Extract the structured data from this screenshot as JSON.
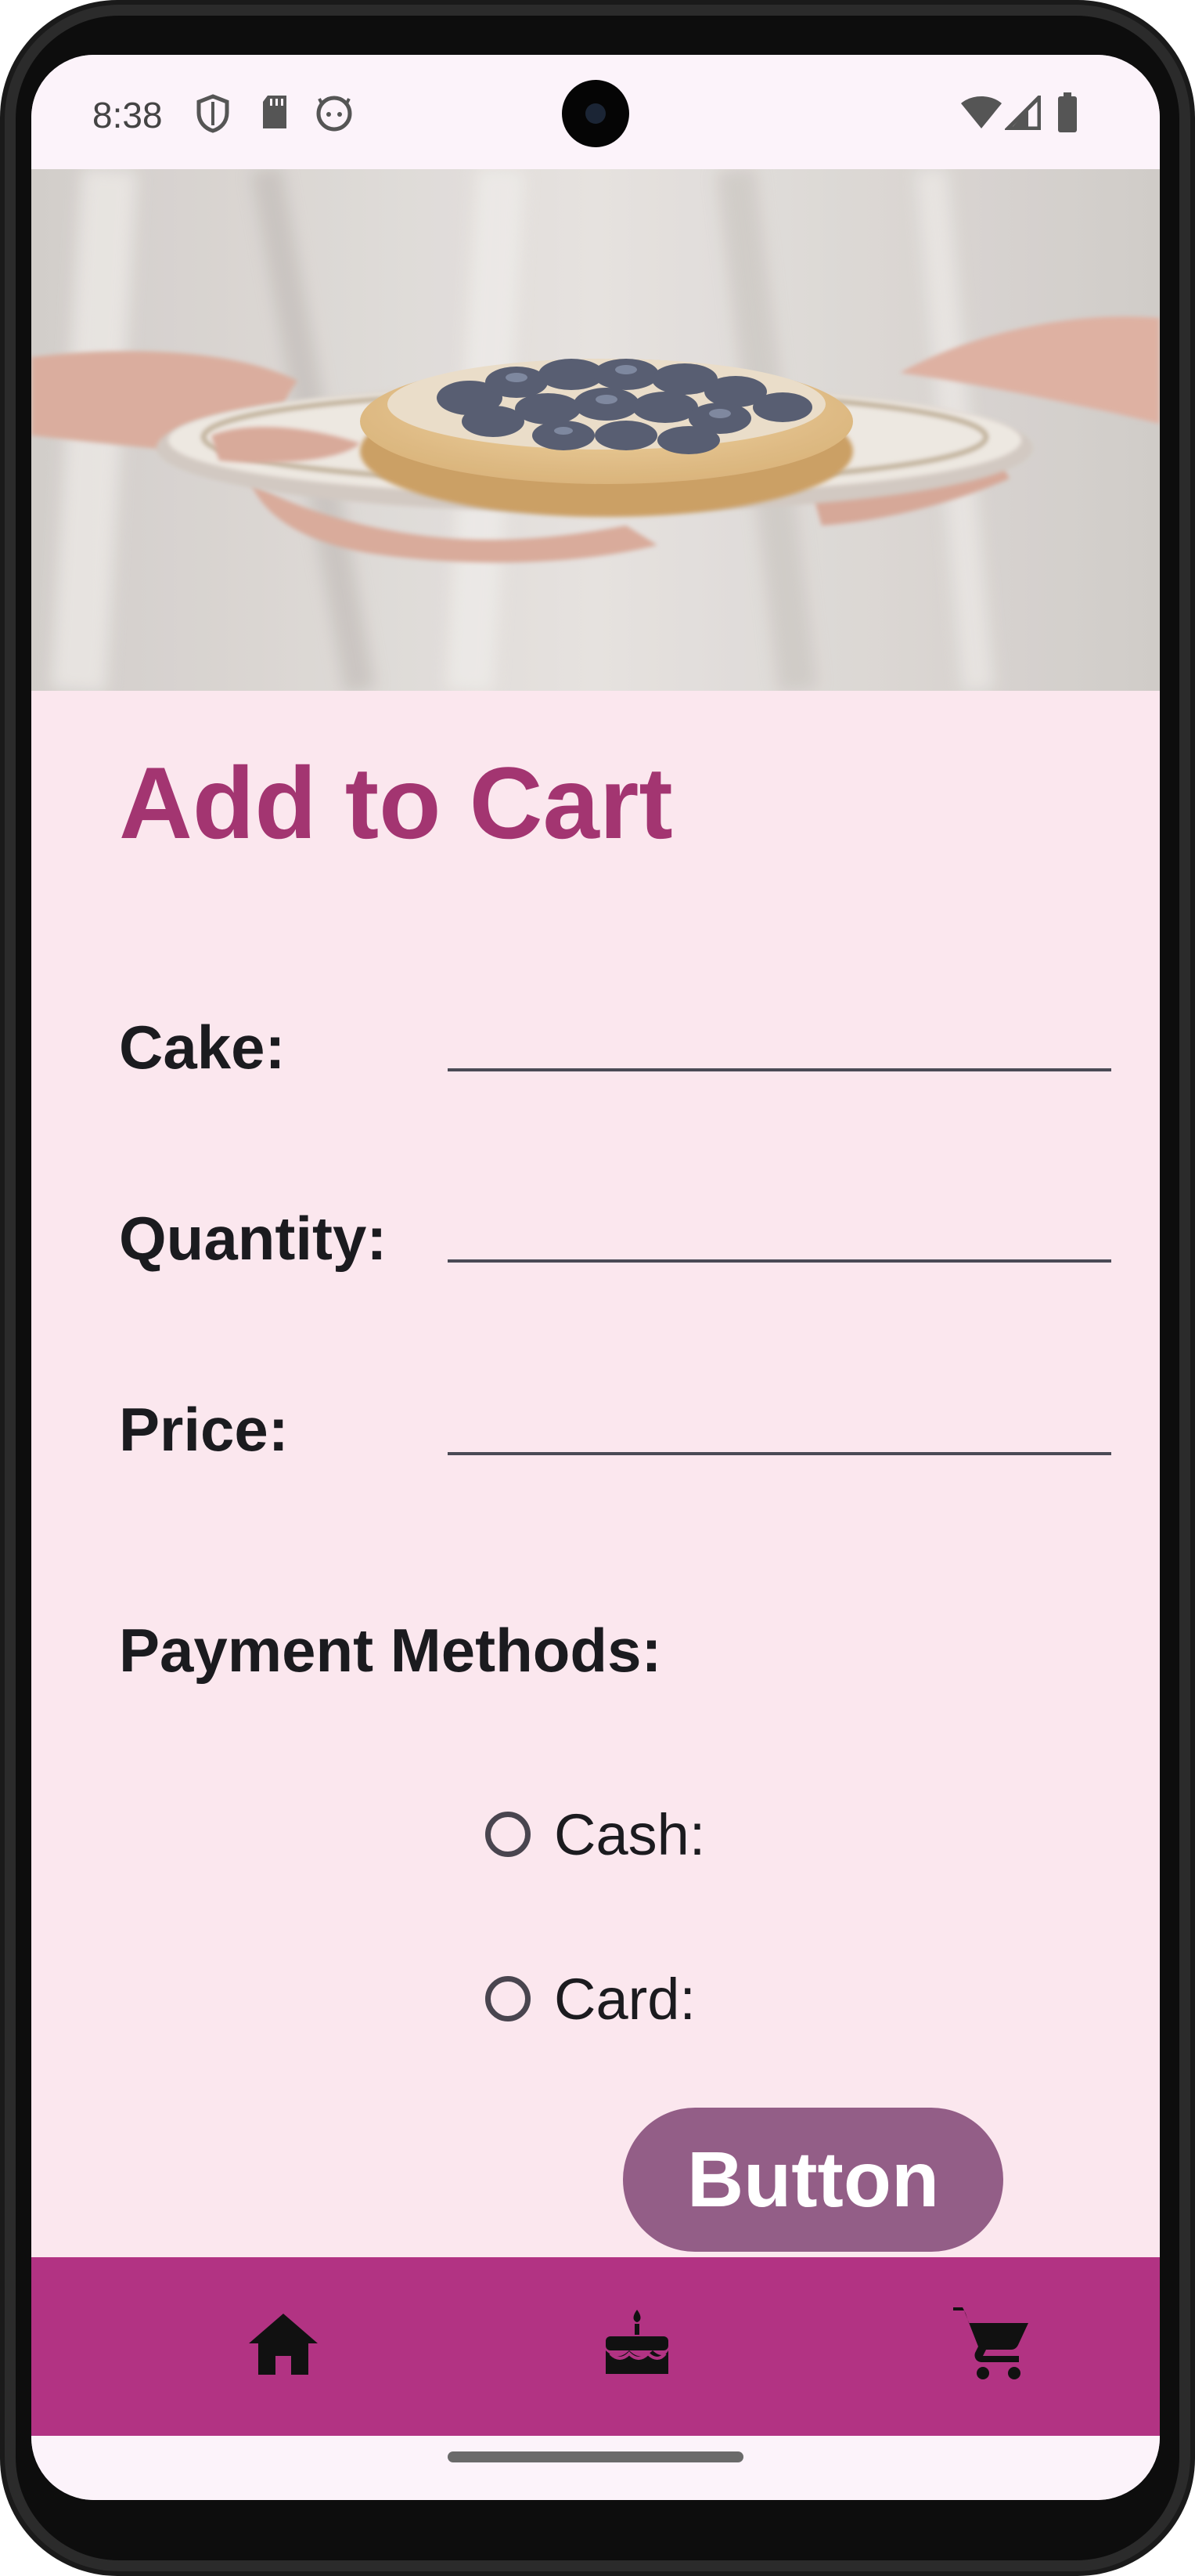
{
  "status_bar": {
    "time": "8:38",
    "left_icons": [
      "shield-icon",
      "sd-card-icon",
      "android-face-icon"
    ],
    "right_icons": [
      "wifi-icon",
      "signal-icon",
      "battery-icon"
    ]
  },
  "hero": {
    "image": "blueberry-tart-on-plate"
  },
  "form": {
    "title": "Add to Cart",
    "fields": [
      {
        "label": "Cake:",
        "value": ""
      },
      {
        "label": "Quantity:",
        "value": ""
      },
      {
        "label": "Price:",
        "value": ""
      }
    ],
    "payment_label": "Payment Methods:",
    "payment_options": [
      {
        "label": "Cash:",
        "selected": false
      },
      {
        "label": "Card:",
        "selected": false
      }
    ],
    "button_label": "Button"
  },
  "bottom_nav": {
    "items": [
      {
        "icon": "home-icon"
      },
      {
        "icon": "cake-icon"
      },
      {
        "icon": "cart-icon"
      }
    ]
  },
  "colors": {
    "title": "#a33571",
    "content_bg": "#fbe7ee",
    "button_bg": "#935e87",
    "nav_bg": "#b23383",
    "status_bg": "#fcf3fa"
  }
}
